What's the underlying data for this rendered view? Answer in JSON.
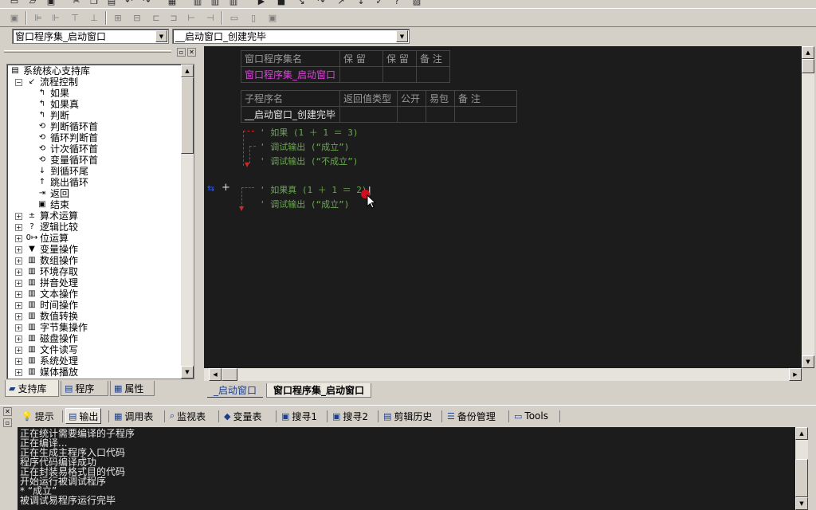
{
  "combobar": {
    "class_select": "窗口程序集_启动窗口",
    "sub_select": "__启动窗口_创建完毕"
  },
  "tree": {
    "root": "系统核心支持库",
    "group": "流程控制",
    "flow_items": [
      "如果",
      "如果真",
      "判断",
      "判断循环首",
      "循环判断首",
      "计次循环首",
      "变量循环首",
      "到循环尾",
      "跳出循环",
      "返回",
      "结束"
    ],
    "categories": [
      "算术运算",
      "逻辑比较",
      "位运算",
      "变量操作",
      "数组操作",
      "环境存取",
      "拼音处理",
      "文本操作",
      "时间操作",
      "数值转换",
      "字节集操作",
      "磁盘操作",
      "文件读写",
      "系统处理",
      "媒体播放"
    ]
  },
  "left_tabs": {
    "library": "支持库",
    "program": "程序",
    "properties": "属性"
  },
  "editor": {
    "class_table": {
      "headers": [
        "窗口程序集名",
        "保 留",
        "保 留",
        "备 注"
      ],
      "name": "窗口程序集_启动窗口"
    },
    "sub_table": {
      "headers": [
        "子程序名",
        "返回值类型",
        "公开",
        "易包",
        "备 注"
      ],
      "name": "__启动窗口_创建完毕"
    },
    "code_lines": [
      "如果 (1 ＋ 1 ＝ 3)",
      "调试输出 (“成立”)",
      "调试输出 (“不成立”)",
      "如果真 (1 ＋ 1 ＝ 2)",
      "调试输出 (“成立”)"
    ]
  },
  "doc_tabs": [
    "_启动窗口",
    "窗口程序集_启动窗口"
  ],
  "output_tabs": [
    "提示",
    "输出",
    "调用表",
    "监视表",
    "变量表",
    "搜寻1",
    "搜寻2",
    "剪辑历史",
    "备份管理",
    "Tools"
  ],
  "output_lines": [
    "正在统计需要编译的子程序",
    "正在编译...",
    "正在生成主程序入口代码",
    "程序代码编译成功",
    "正在封装易格式目的代码",
    "开始运行被调试程序",
    "* “成立”",
    "被调试易程序运行完毕"
  ]
}
